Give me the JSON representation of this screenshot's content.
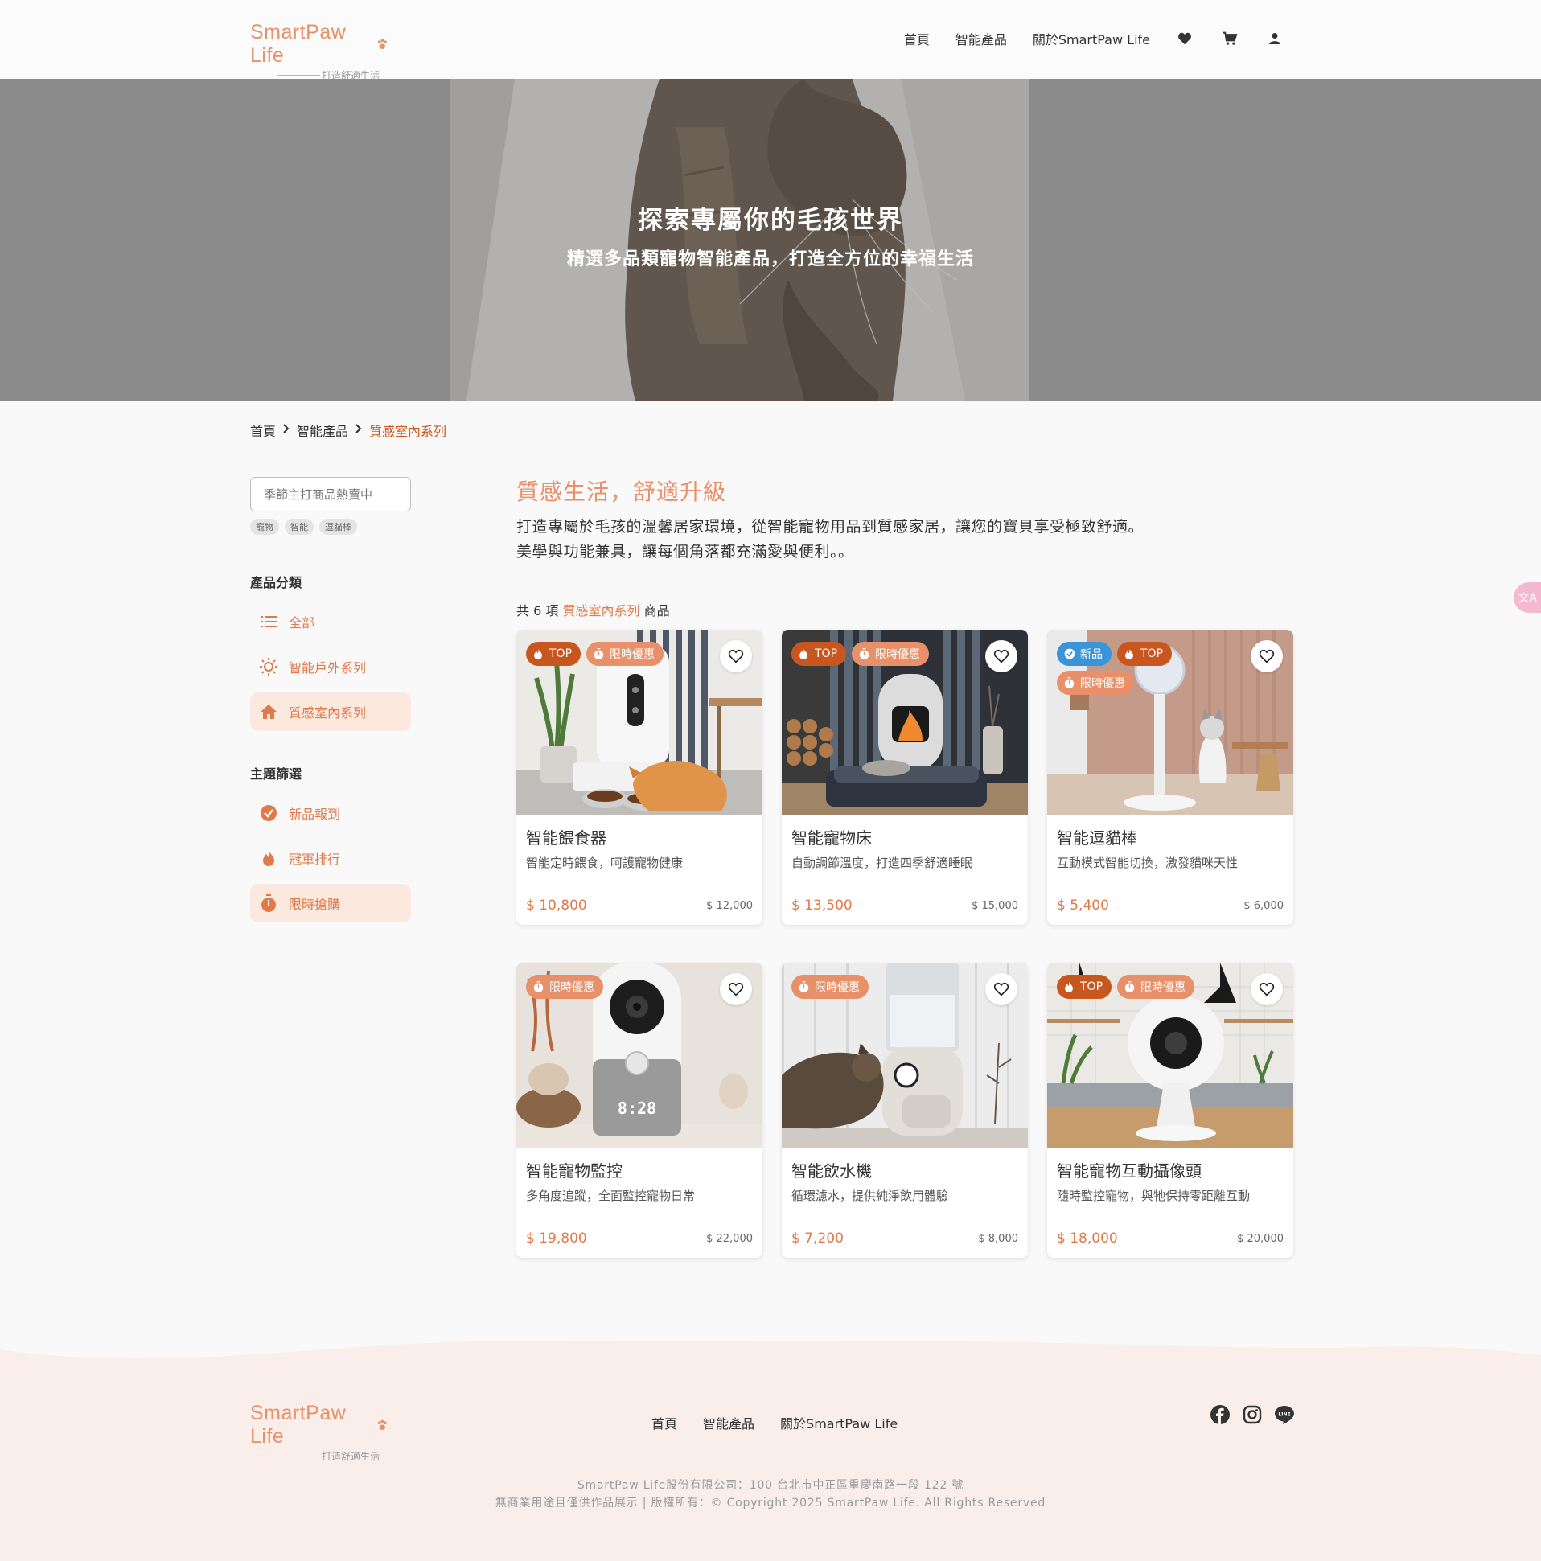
{
  "brand": {
    "name": "SmartPaw Life",
    "tagline": "打造舒適生活"
  },
  "nav": {
    "items": [
      "首頁",
      "智能產品",
      "關於SmartPaw Life"
    ]
  },
  "hero": {
    "title": "探索專屬你的毛孩世界",
    "subtitle": "精選多品類寵物智能產品，打造全方位的幸福生活"
  },
  "breadcrumb": [
    "首頁",
    "智能產品",
    "質感室內系列"
  ],
  "search": {
    "placeholder": "季節主打商品熱賣中",
    "tags": [
      "寵物",
      "智能",
      "逗貓棒"
    ]
  },
  "sidebar": {
    "category_title": "產品分類",
    "categories": [
      "全部",
      "智能戶外系列",
      "質感室內系列"
    ],
    "theme_title": "主題篩選",
    "themes": [
      "新品報到",
      "冠軍排行",
      "限時搶購"
    ]
  },
  "main": {
    "heading": "質感生活，舒適升級",
    "desc_line1": "打造專屬於毛孩的溫馨居家環境，從智能寵物用品到質感家居，讓您的寶貝享受極致舒適。",
    "desc_line2": "美學與功能兼具，讓每個角落都充滿愛與便利。。",
    "count_prefix": "共 6 項",
    "count_category": "質感室內系列",
    "count_suffix": "商品"
  },
  "badges": {
    "top": "TOP",
    "sale": "限時優惠",
    "new": "新品"
  },
  "products": [
    {
      "name": "智能餵食器",
      "desc": "智能定時餵食，呵護寵物健康",
      "price": "$ 10,800",
      "old": "$ 12,000"
    },
    {
      "name": "智能寵物床",
      "desc": "自動調節溫度，打造四季舒適睡眠",
      "price": "$ 13,500",
      "old": "$ 15,000"
    },
    {
      "name": "智能逗貓棒",
      "desc": "互動模式智能切換，激發貓咪天性",
      "price": "$ 5,400",
      "old": "$ 6,000"
    },
    {
      "name": "智能寵物監控",
      "desc": "多角度追蹤，全面監控寵物日常",
      "price": "$ 19,800",
      "old": "$ 22,000",
      "clock": "8:28"
    },
    {
      "name": "智能飲水機",
      "desc": "循環濾水，提供純淨飲用體驗",
      "price": "$ 7,200",
      "old": "$ 8,000"
    },
    {
      "name": "智能寵物互動攝像頭",
      "desc": "隨時監控寵物，與牠保持零距離互動",
      "price": "$ 18,000",
      "old": "$ 20,000"
    }
  ],
  "footer": {
    "nav": [
      "首頁",
      "智能產品",
      "關於SmartPaw Life"
    ],
    "line_badge": "LINE",
    "address": "SmartPaw Life股份有限公司：100 台北市中正區重慶南路一段 122 號",
    "copyright": "無商業用途且僅供作品展示 | 版權所有：© Copyright 2025 SmartPaw Life. All Rights Reserved"
  },
  "translate_fab": "文A",
  "colors": {
    "accent": "#e8906a",
    "accent_dark": "#c8571f",
    "new_badge": "#3c94d8"
  }
}
